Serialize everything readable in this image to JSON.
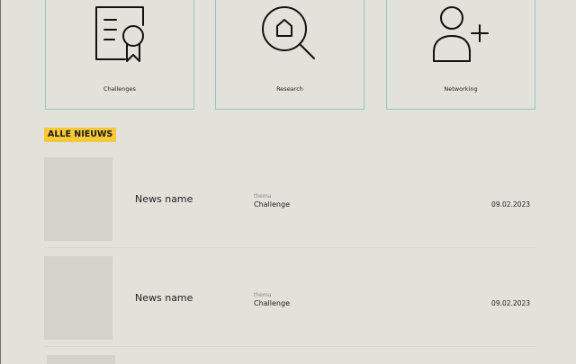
{
  "categories": [
    {
      "label": "Challenges",
      "icon": "certificate-icon"
    },
    {
      "label": "Research",
      "icon": "home-search-icon"
    },
    {
      "label": "Networking",
      "icon": "user-add-icon"
    }
  ],
  "news_section": {
    "tag": "ALLE NIEUWS"
  },
  "news": [
    {
      "name": "News name",
      "theme_label": "thema",
      "theme": "Challenge",
      "date": "09.02.2023"
    },
    {
      "name": "News name",
      "theme_label": "thema",
      "theme": "Challenge",
      "date": "09.02.2023"
    }
  ],
  "colors": {
    "background": "#e2e1da",
    "card_border": "#8fc8c2",
    "accent": "#f7c938",
    "thumbnail": "#d4d3c9"
  }
}
